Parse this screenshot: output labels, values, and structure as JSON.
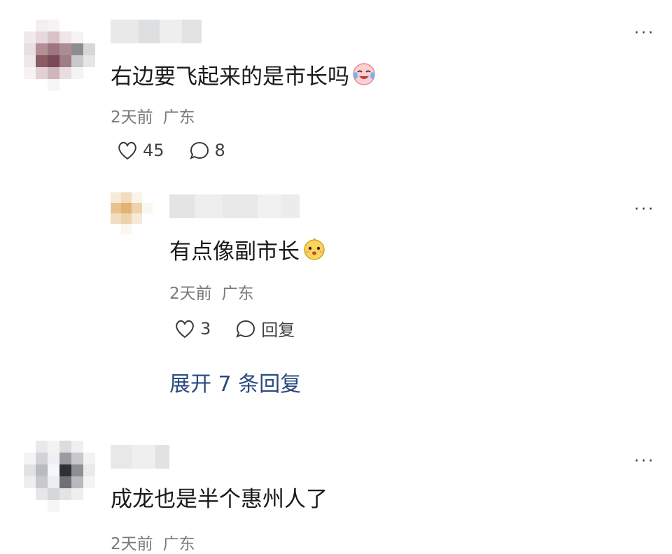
{
  "comments": [
    {
      "text": "右边要飞起来的是市长吗",
      "emoji": "crying-laughing-face",
      "time": "2天前",
      "location": "广东",
      "likes": "45",
      "replies": "8"
    },
    {
      "text": "有点像副市长",
      "emoji": "cute-face",
      "time": "2天前",
      "location": "广东",
      "likes": "3",
      "reply_label": "回复",
      "expand_label": "展开 7 条回复"
    },
    {
      "text": "成龙也是半个惠州人了",
      "time": "2天前",
      "location": "广东"
    }
  ],
  "more_label": "···",
  "colors": {
    "link": "#2a4a7f",
    "meta": "#7a7a7a",
    "text": "#1a1a1a"
  }
}
